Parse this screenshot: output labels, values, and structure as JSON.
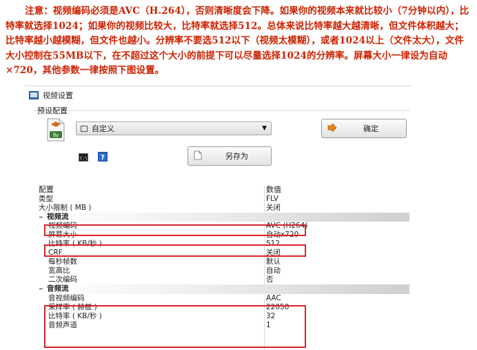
{
  "note": "注意：视频编码必须是AVC（H.264），否则清晰度会下降。如果你的视频本来就比较小（7分钟以内），比特率就选择1024；如果你的视频比较大，比特率就选择512。总体来说比特率越大越清晰，但文件体积越大；比特率越小越模糊，但文件也越小。分辨率不要选512以下（视频太模糊），或者1024以上（文件太大），文件大小控制在55MB以下，在不超过这个大小的前提下可以尽量选择1024的分辨率。屏幕大小一律设为自动×720，其他参数一律按照下图设置。",
  "window": {
    "title": "视频设置"
  },
  "preset": {
    "group_label": "预设配置",
    "icon_text": "flv",
    "selected": "自定义",
    "ok_label": "确定",
    "save_as_label": "另存为"
  },
  "grid": {
    "header": {
      "key": "配置",
      "value": "数值"
    },
    "top_rows": [
      {
        "key": "类型",
        "value": "FLV"
      },
      {
        "key": "大小限制 ( MB )",
        "value": "关闭"
      }
    ],
    "video": {
      "label": "视频流",
      "rows": [
        {
          "key": "视频编码",
          "value": "AVC (H264)"
        },
        {
          "key": "屏幕大小",
          "value": "自动x720"
        },
        {
          "key": "比特率 ( KB/秒 )",
          "value": "512"
        },
        {
          "key": "CRF",
          "value": "关闭"
        },
        {
          "key": "每秒帧数",
          "value": "默认"
        },
        {
          "key": "宽高比",
          "value": "自动"
        },
        {
          "key": "二次编码",
          "value": "否"
        }
      ]
    },
    "audio": {
      "label": "音频流",
      "rows": [
        {
          "key": "音视频编码",
          "value": "AAC"
        },
        {
          "key": "采样率 ( 赫兹 )",
          "value": "22050"
        },
        {
          "key": "比特率 ( KB/秒 )",
          "value": "32"
        },
        {
          "key": "音频声道",
          "value": "1"
        }
      ]
    }
  },
  "colors": {
    "note_text": "#cc2200",
    "highlight": "#d8222a",
    "ok_arrow": "#e8831a"
  }
}
